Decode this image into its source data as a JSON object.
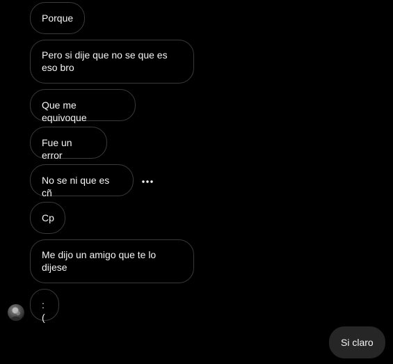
{
  "thread": {
    "incoming": [
      {
        "text": "Porque"
      },
      {
        "text": "Pero si dije que no se que es eso bro"
      },
      {
        "text": "Que me equivoque"
      },
      {
        "text": "Fue un error"
      },
      {
        "text": "No se ni que es cñ"
      },
      {
        "text": "Cp"
      },
      {
        "text": "Me dijo un amigo que te lo dijese"
      },
      {
        "text": ":("
      }
    ],
    "outgoing": [
      {
        "text": "Si claro"
      }
    ]
  },
  "icons": {
    "more_options": "more-options-icon",
    "avatar": "contact-avatar"
  },
  "colors": {
    "background": "#000000",
    "incoming_border": "#3a3a3a",
    "outgoing_fill": "#262626",
    "text": "#f5f5f5"
  }
}
